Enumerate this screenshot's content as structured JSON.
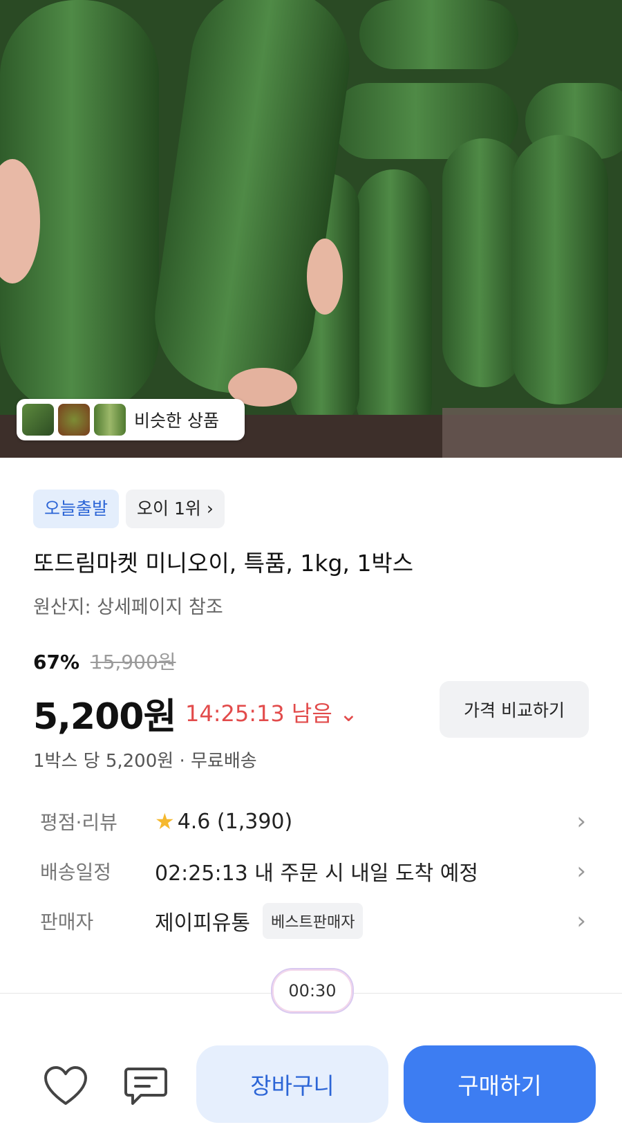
{
  "hero": {
    "similar_label": "비슷한 상품",
    "thumbnails": [
      "cucumber-thumb-1",
      "cucumber-thumb-2",
      "cucumber-thumb-3"
    ]
  },
  "badges": {
    "today_ship": "오늘출발",
    "rank": "오이 1위 ›"
  },
  "product": {
    "title": "또드림마켓 미니오이, 특품, 1kg, 1박스",
    "origin": "원산지: 상세페이지 참조",
    "discount": "67%",
    "original_price": "15,900원",
    "price": "5,200원",
    "timer": "14:25:13 남음 ⌄",
    "compare_label": "가격 비교하기",
    "unit_price": "1박스 당 5,200원 · 무료배송"
  },
  "info": {
    "rating_key": "평점·리뷰",
    "rating_value": "4.6 (1,390)",
    "delivery_key": "배송일정",
    "delivery_value": "02:25:13 내 주문 시 내일 도착 예정",
    "seller_key": "판매자",
    "seller_value": "제이피유통",
    "seller_badge": "베스트판매자",
    "chevron": "›"
  },
  "countdown": "00:30",
  "bottom": {
    "cart_label": "장바구니",
    "buy_label": "구매하기"
  },
  "colors": {
    "accent": "#3d7df2",
    "sale_red": "#e24b4b",
    "badge_blue": "#2c65d6",
    "star": "#f5b82e"
  }
}
